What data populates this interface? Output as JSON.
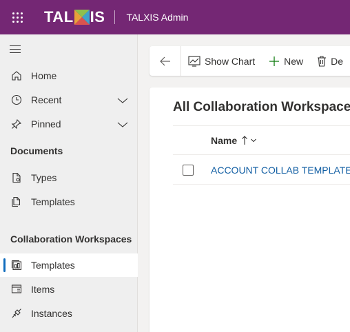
{
  "header": {
    "logo_left": "TAL",
    "logo_right": "IS",
    "app_title": "TALXIS Admin",
    "color": "#742774"
  },
  "sidebar": {
    "top_items": [
      {
        "label": "Home",
        "icon": "home-icon"
      },
      {
        "label": "Recent",
        "icon": "clock-icon"
      },
      {
        "label": "Pinned",
        "icon": "pin-icon"
      }
    ],
    "sections": [
      {
        "title": "Documents",
        "items": [
          {
            "label": "Types",
            "icon": "document-gear-icon"
          },
          {
            "label": "Templates",
            "icon": "document-copy-icon"
          }
        ]
      },
      {
        "title": "Collaboration Workspaces",
        "items": [
          {
            "label": "Templates",
            "icon": "board-template-icon",
            "selected": true
          },
          {
            "label": "Items",
            "icon": "window-list-icon"
          },
          {
            "label": "Instances",
            "icon": "plug-icon"
          }
        ]
      }
    ],
    "accent": "#0f6cbd"
  },
  "commandbar": {
    "show_chart": "Show Chart",
    "new": "New",
    "delete": "De"
  },
  "view": {
    "title": "All Collaboration Workspaces",
    "columns": [
      {
        "label": "Name"
      }
    ],
    "rows": [
      {
        "name": "ACCOUNT COLLAB TEMPLATE"
      }
    ]
  }
}
